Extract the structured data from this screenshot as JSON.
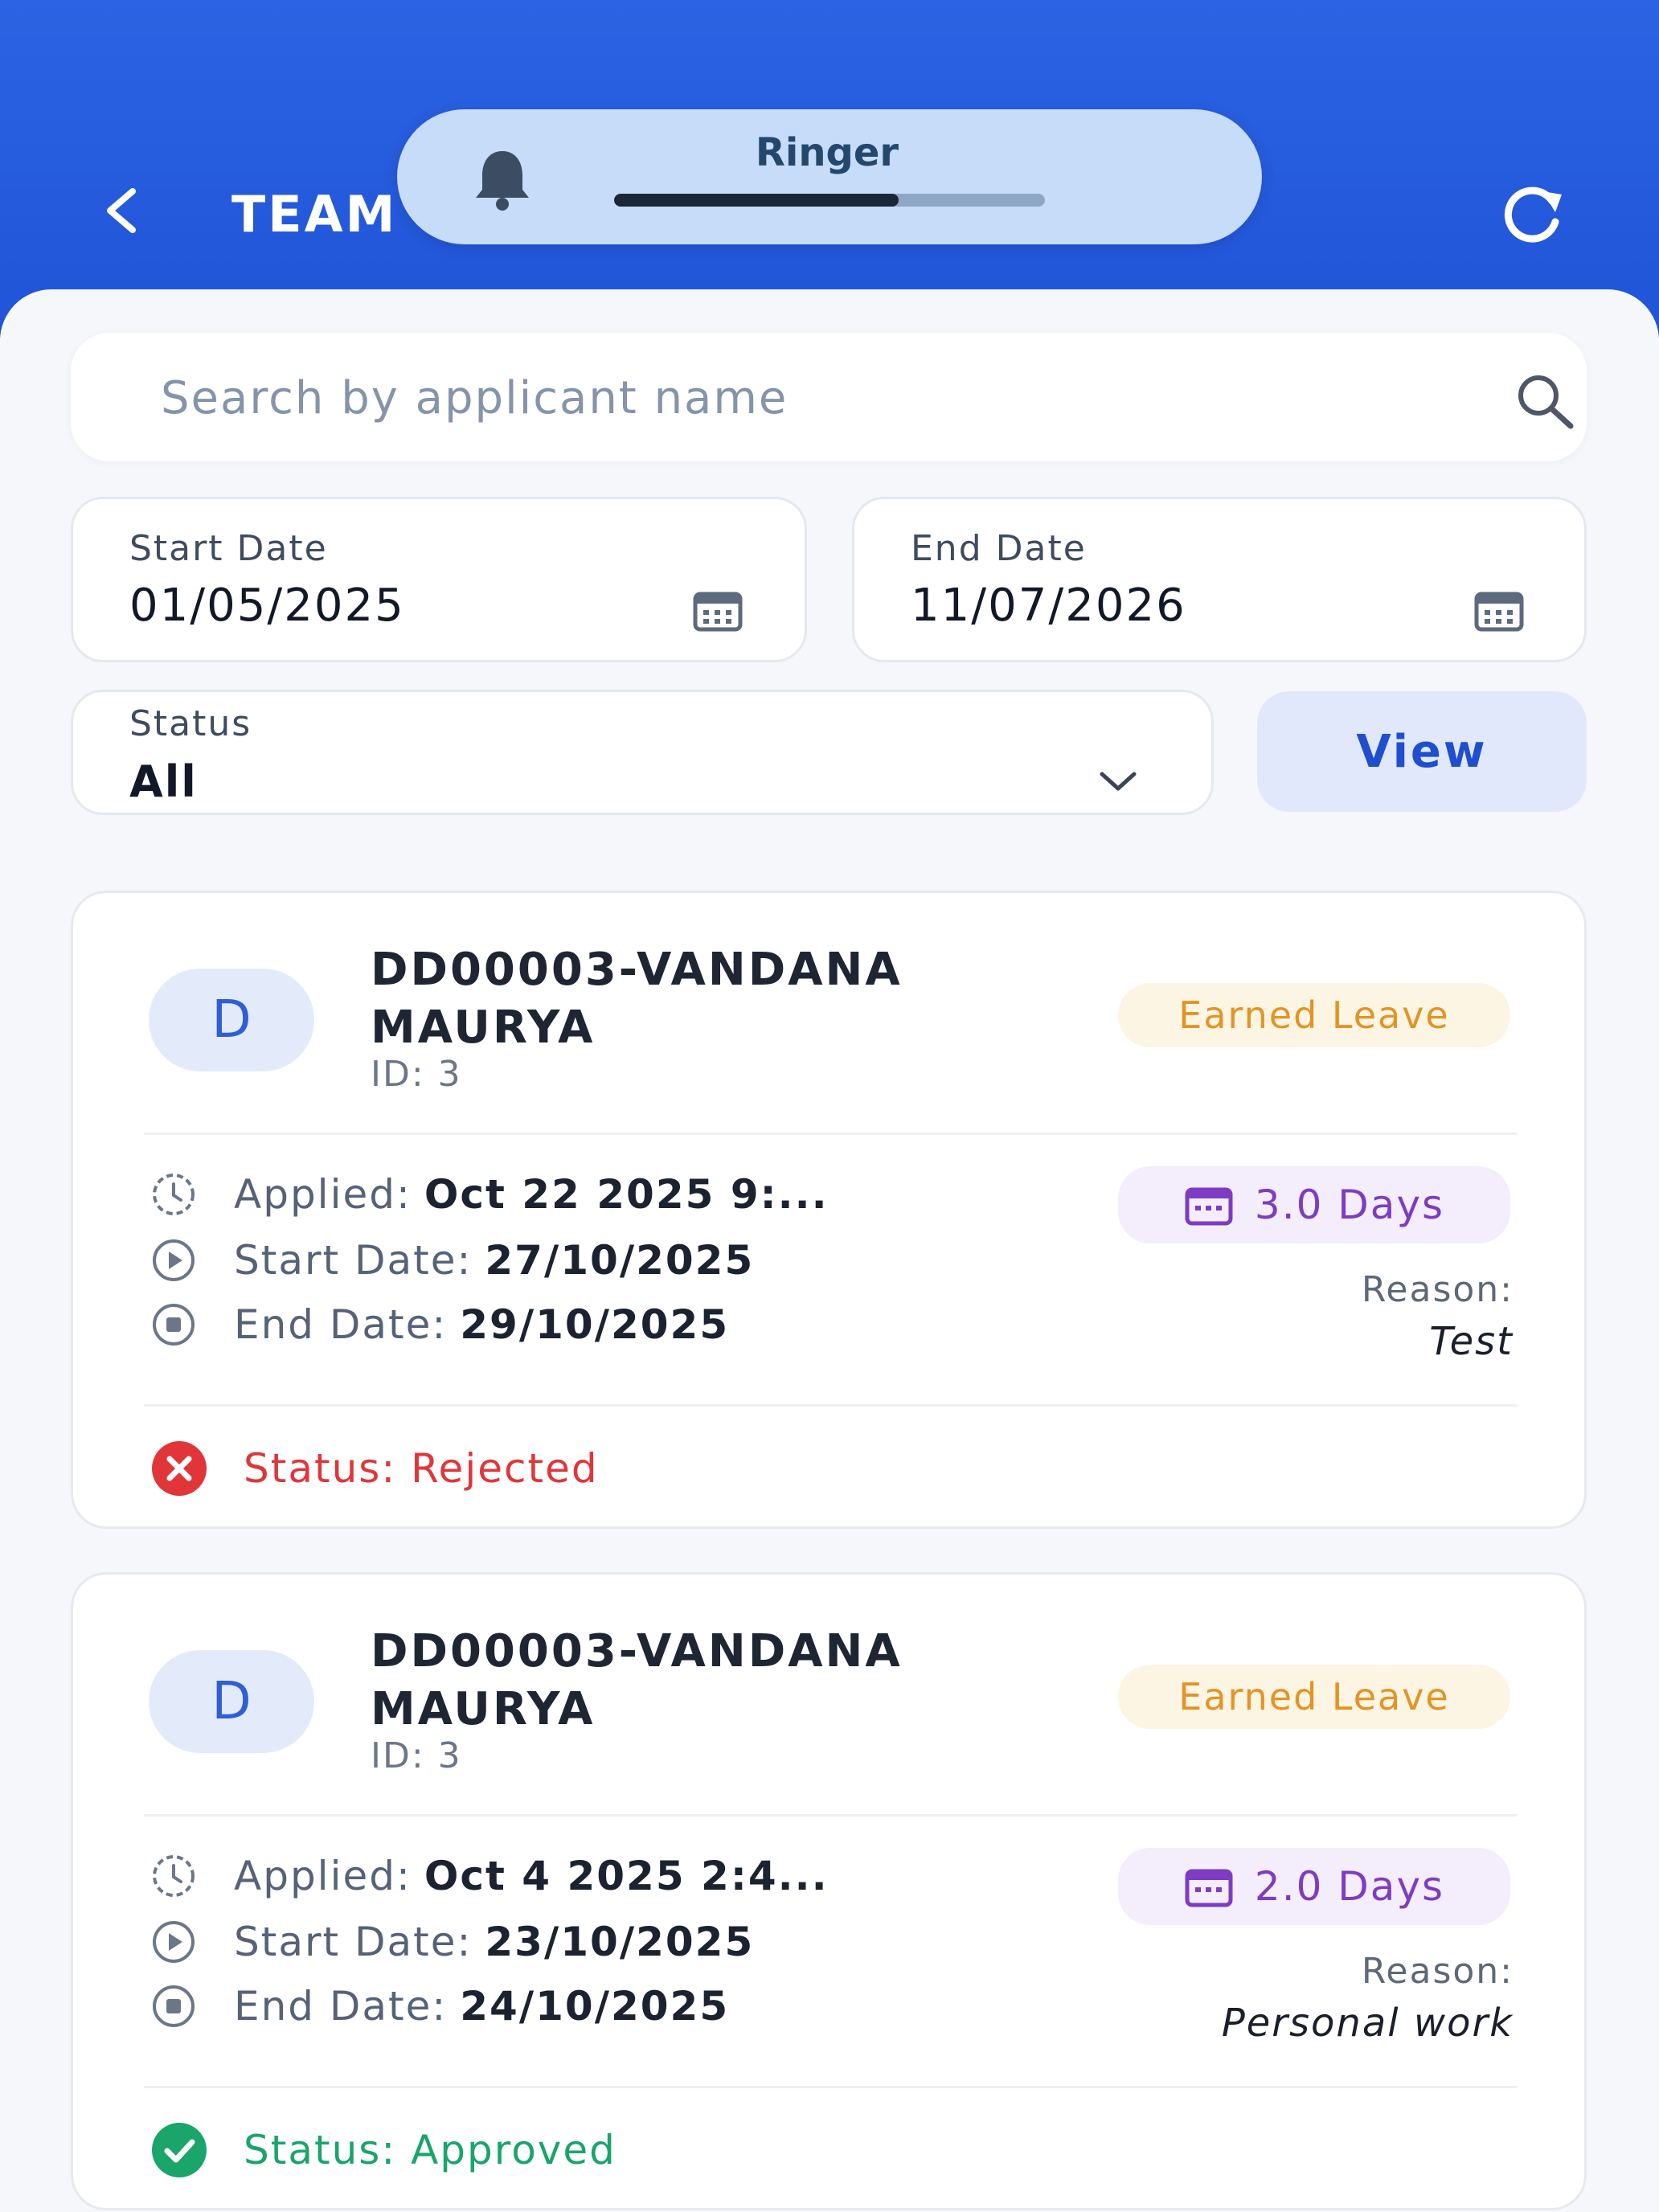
{
  "header": {
    "title": "TEAM",
    "back_icon": "chevron-left-icon",
    "refresh_icon": "refresh-icon"
  },
  "ringer_overlay": {
    "label": "Ringer",
    "icon": "bell-icon",
    "volume_fraction": 0.66
  },
  "search": {
    "placeholder": "Search by applicant name",
    "value": ""
  },
  "filters": {
    "start_date": {
      "label": "Start Date",
      "value": "01/05/2025"
    },
    "end_date": {
      "label": "End Date",
      "value": "11/07/2026"
    },
    "status": {
      "label": "Status",
      "value": "All"
    },
    "view_label": "View"
  },
  "labels": {
    "applied": "Applied:",
    "start_date": "Start Date:",
    "end_date": "End Date:",
    "reason": "Reason:"
  },
  "colors": {
    "header_blue": "#2b63e3",
    "rejected": "#e0363a",
    "approved": "#1aa56a",
    "leave_badge": "#e39425",
    "days_badge": "#7d3cc2"
  },
  "cards": [
    {
      "avatar_letter": "D",
      "name": "DD00003-VANDANA MAURYA",
      "id": "ID: 3",
      "leave_type": "Earned Leave",
      "applied": "Oct 22 2025  9:...",
      "start": "27/10/2025",
      "end": "29/10/2025",
      "days": "3.0 Days",
      "reason": "Test",
      "status": "Status: Rejected"
    },
    {
      "avatar_letter": "D",
      "name": "DD00003-VANDANA MAURYA",
      "id": "ID: 3",
      "leave_type": "Earned Leave",
      "applied": "Oct  4 2025  2:4...",
      "start": "23/10/2025",
      "end": "24/10/2025",
      "days": "2.0 Days",
      "reason": "Personal work",
      "status": "Status: Approved"
    }
  ]
}
